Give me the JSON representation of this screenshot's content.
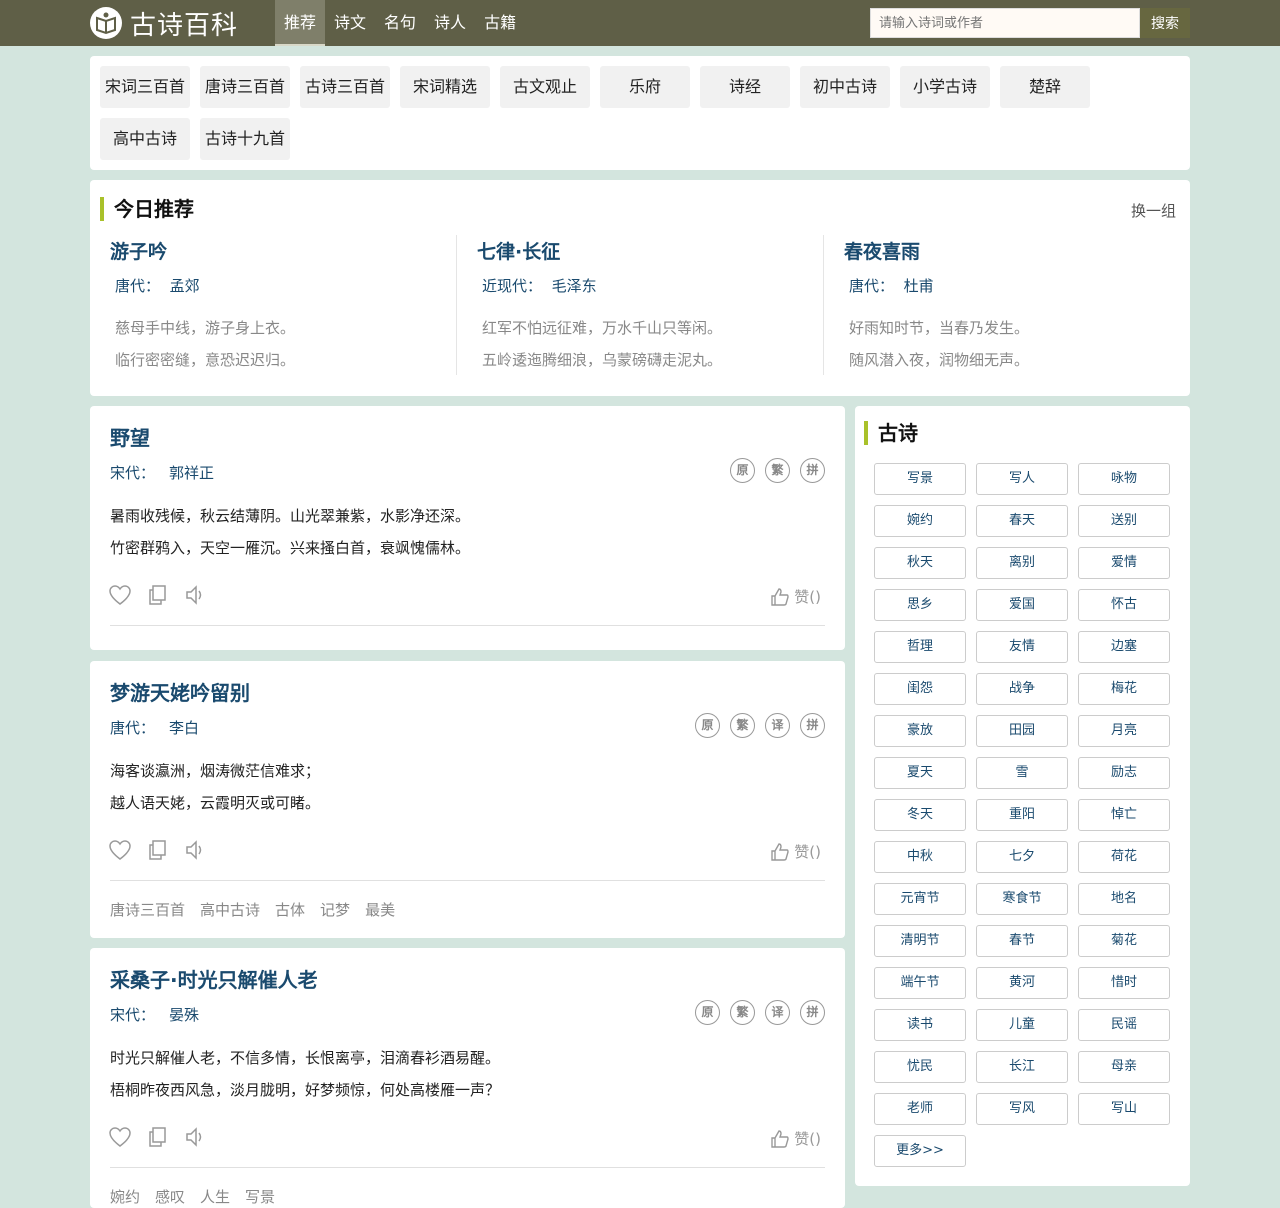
{
  "header": {
    "logo_icon": "book-logo-icon",
    "site_name": "古诗百科",
    "nav": [
      "推荐",
      "诗文",
      "名句",
      "诗人",
      "古籍"
    ],
    "search_placeholder": "请输入诗词或作者",
    "search_button": "搜索"
  },
  "categories": [
    "宋词三百首",
    "唐诗三百首",
    "古诗三百首",
    "宋词精选",
    "古文观止",
    "乐府",
    "诗经",
    "初中古诗",
    "小学古诗",
    "楚辞",
    "高中古诗",
    "古诗十九首"
  ],
  "today": {
    "title": "今日推荐",
    "change": "换一组",
    "items": [
      {
        "title": "游子吟",
        "dynasty": "唐代：",
        "author": "孟郊",
        "lines": [
          "慈母手中线，游子身上衣。",
          "临行密密缝，意恐迟迟归。"
        ]
      },
      {
        "title": "七律·长征",
        "dynasty": "近现代：",
        "author": "毛泽东",
        "lines": [
          "红军不怕远征难，万水千山只等闲。",
          "五岭逶迤腾细浪，乌蒙磅礴走泥丸。"
        ]
      },
      {
        "title": "春夜喜雨",
        "dynasty": "唐代：",
        "author": "杜甫",
        "lines": [
          "好雨知时节，当春乃发生。",
          "随风潜入夜，润物细无声。"
        ]
      }
    ]
  },
  "poems": [
    {
      "title": "野望",
      "dynasty": "宋代：",
      "author": "郭祥正",
      "badges": [
        "原",
        "繁",
        "拼"
      ],
      "lines": [
        "暑雨收残候，秋云结薄阴。山光翠兼紫，水影净还深。",
        "竹密群鸦入，天空一雁沉。兴来搔白首，衰飒愧儒林。"
      ],
      "like": "赞()",
      "tags": []
    },
    {
      "title": "梦游天姥吟留别",
      "dynasty": "唐代：",
      "author": "李白",
      "badges": [
        "原",
        "繁",
        "译",
        "拼"
      ],
      "lines": [
        "海客谈瀛洲，烟涛微茫信难求；",
        "越人语天姥，云霞明灭或可睹。"
      ],
      "like": "赞()",
      "tags": [
        "唐诗三百首",
        "高中古诗",
        "古体",
        "记梦",
        "最美"
      ]
    },
    {
      "title": "采桑子·时光只解催人老",
      "dynasty": "宋代：",
      "author": "晏殊",
      "badges": [
        "原",
        "繁",
        "译",
        "拼"
      ],
      "lines": [
        "时光只解催人老，不信多情，长恨离亭，泪滴春衫酒易醒。",
        "梧桐昨夜西风急，淡月胧明，好梦频惊，何处高楼雁一声？"
      ],
      "like": "赞()",
      "tags": [
        "婉约",
        "感叹",
        "人生",
        "写景"
      ]
    }
  ],
  "sidebar": {
    "title": "古诗",
    "tags": [
      "写景",
      "写人",
      "咏物",
      "婉约",
      "春天",
      "送别",
      "秋天",
      "离别",
      "爱情",
      "思乡",
      "爱国",
      "怀古",
      "哲理",
      "友情",
      "边塞",
      "闺怨",
      "战争",
      "梅花",
      "豪放",
      "田园",
      "月亮",
      "夏天",
      "雪",
      "励志",
      "冬天",
      "重阳",
      "悼亡",
      "中秋",
      "七夕",
      "荷花",
      "元宵节",
      "寒食节",
      "地名",
      "清明节",
      "春节",
      "菊花",
      "端午节",
      "黄河",
      "惜时",
      "读书",
      "儿童",
      "民谣",
      "忧民",
      "长江",
      "母亲",
      "老师",
      "写风",
      "写山"
    ],
    "more": "更多>>"
  }
}
